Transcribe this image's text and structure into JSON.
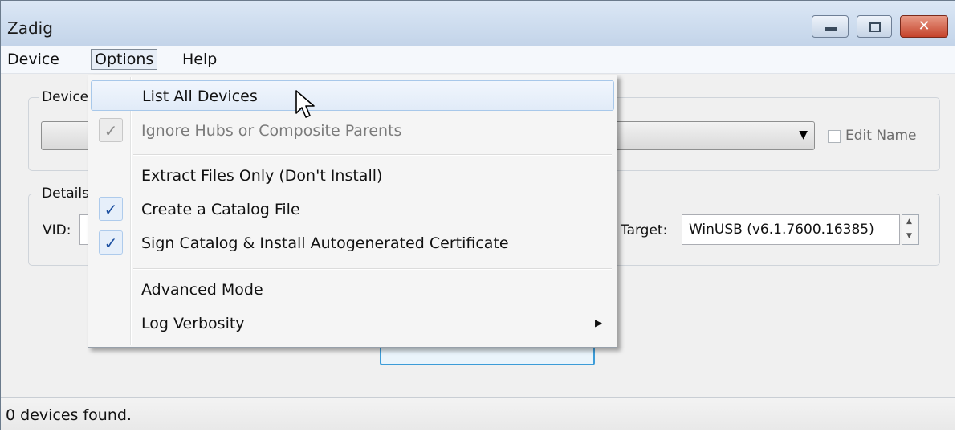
{
  "window": {
    "title": "Zadig",
    "controls": {
      "minimize_icon": "minimize-icon",
      "maximize_icon": "maximize-icon",
      "close_icon": "close-icon",
      "close_glyph": "✕"
    }
  },
  "menubar": {
    "items": [
      {
        "label": "Device"
      },
      {
        "label": "Options",
        "active": true
      },
      {
        "label": "Help"
      }
    ]
  },
  "device_group": {
    "legend": "Device",
    "edit_name_label": "Edit Name"
  },
  "details_group": {
    "legend": "Details",
    "vid_label": "VID:",
    "target_label": "Target:",
    "target_value": "WinUSB (v6.1.7600.16385)"
  },
  "options_menu": {
    "items": [
      {
        "label": "List All Devices",
        "checked": false,
        "enabled": true,
        "highlighted": true
      },
      {
        "label": "Ignore Hubs or Composite Parents",
        "checked": true,
        "enabled": false
      },
      {
        "label": "Extract Files Only (Don't Install)",
        "checked": false,
        "enabled": true
      },
      {
        "label": "Create a Catalog File",
        "checked": true,
        "enabled": true
      },
      {
        "label": "Sign Catalog & Install Autogenerated Certificate",
        "checked": true,
        "enabled": true
      },
      {
        "label": "Advanced Mode",
        "checked": false,
        "enabled": true
      },
      {
        "label": "Log Verbosity",
        "checked": false,
        "enabled": true,
        "submenu": true
      }
    ],
    "check_glyph": "✓",
    "submenu_glyph": "▶"
  },
  "status": {
    "text": "0 devices found."
  },
  "colors": {
    "title_bar": "#c3d4e9",
    "accent_blue": "#3c9cd8",
    "close_red": "#c5432b",
    "check_blue": "#1a4ea0"
  }
}
